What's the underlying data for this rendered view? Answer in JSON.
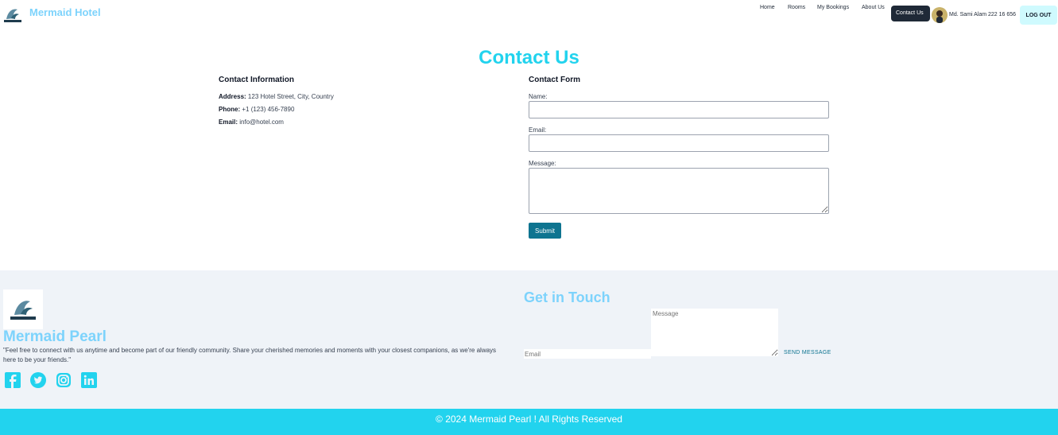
{
  "nav": {
    "brand": "Mermaid Hotel",
    "links": [
      "Home",
      "Rooms",
      "My Bookings",
      "About Us",
      "Contact Us"
    ],
    "active": "Contact Us",
    "user": "Md. Sami Alam 222  16  656",
    "logout": "LOG OUT"
  },
  "contact": {
    "title": "Contact Us",
    "info_heading": "Contact Information",
    "address_label": "Address:",
    "address": "123 Hotel Street, City, Country",
    "phone_label": "Phone:",
    "phone": "+1 (123) 456-7890",
    "email_label": "Email:",
    "email": "info@hotel.com",
    "form_heading": "Contact Form",
    "name_label": "Name:",
    "email_field_label": "Email:",
    "message_label": "Message:",
    "submit": "Submit"
  },
  "footer": {
    "brand": "Mermaid Pearl",
    "quote": "\"Feel free to connect with us anytime and become part of our friendly community. Share your cherished memories and moments with your closest companions, as we're always here to be your friends.\"",
    "social_icons": [
      "facebook-icon",
      "twitter-icon",
      "instagram-icon",
      "linkedin-icon"
    ],
    "get_in_touch": "Get in Touch",
    "message_placeholder": "Message",
    "email_placeholder": "Email",
    "send": "SEND MESSAGE",
    "copyright": "© 2024 Mermaid Pearl ! All Rights Reserved"
  },
  "colors": {
    "accent": "#22d3ee",
    "brand_light": "#7dd3fc",
    "button": "#0e7490",
    "nav_active": "#1f2937",
    "footer_bg": "#eff3f8"
  }
}
